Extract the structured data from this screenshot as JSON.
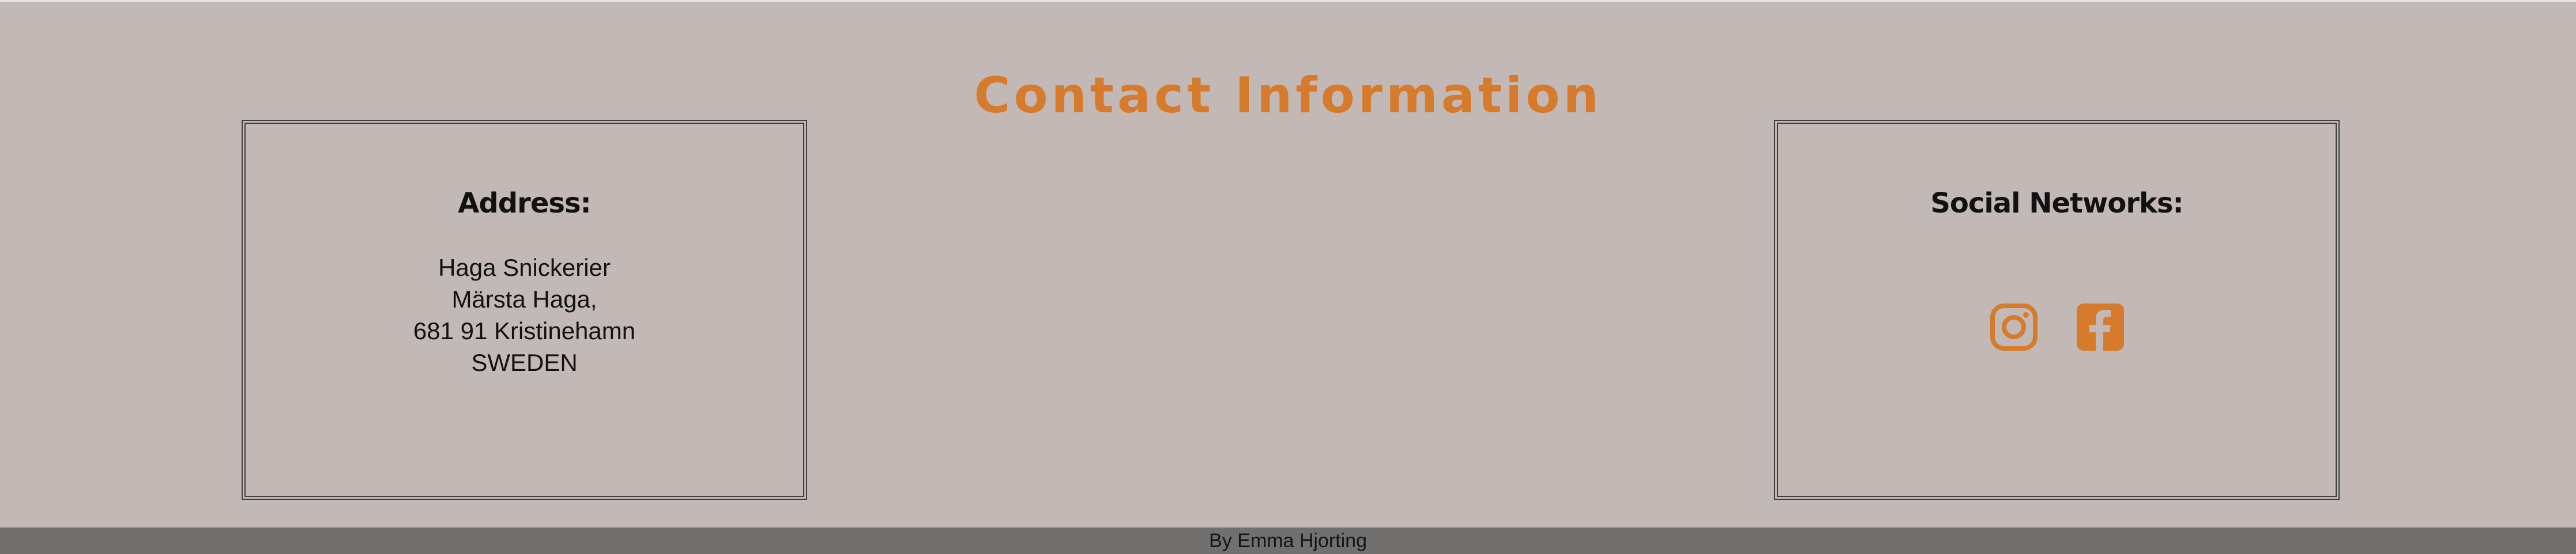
{
  "page": {
    "title": "Contact Information"
  },
  "address": {
    "heading": "Address:",
    "lines": [
      "Haga Snickerier",
      "Märsta Haga,",
      "681 91 Kristinehamn",
      "SWEDEN"
    ]
  },
  "social": {
    "heading": "Social Networks:",
    "icons": [
      "instagram-icon",
      "facebook-icon"
    ]
  },
  "footer": {
    "text": "By Emma Hjorting"
  },
  "colors": {
    "background": "#c2b9b7",
    "accent": "#d67b2b",
    "footer_bg": "#72706e",
    "border": "#3f3f3f"
  }
}
